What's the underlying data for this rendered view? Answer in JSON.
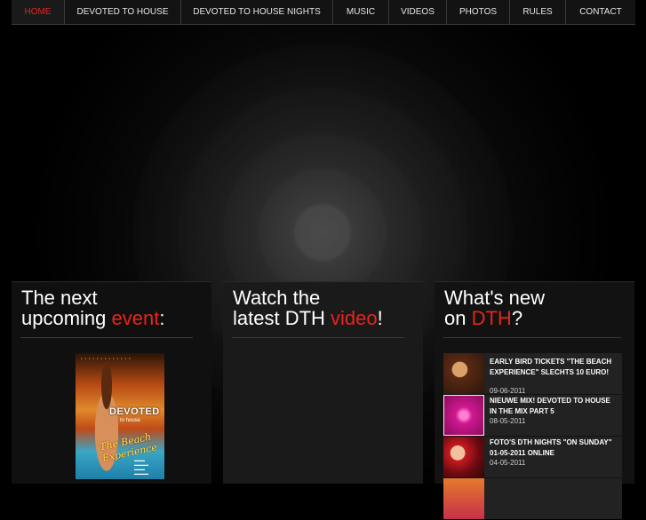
{
  "nav": {
    "items": [
      {
        "label": "HOME",
        "active": true
      },
      {
        "label": "DEVOTED TO HOUSE",
        "active": false
      },
      {
        "label": "DEVOTED TO HOUSE NIGHTS",
        "active": false
      },
      {
        "label": "MUSIC",
        "active": false
      },
      {
        "label": "VIDEOS",
        "active": false
      },
      {
        "label": "PHOTOS",
        "active": false
      },
      {
        "label": "RULES",
        "active": false
      },
      {
        "label": "CONTACT",
        "active": false
      }
    ]
  },
  "colors": {
    "accent": "#e8241d",
    "background": "#000000",
    "panel": "#151515"
  },
  "event_panel": {
    "title_line1": "The next",
    "title_line2_prefix": "upcoming ",
    "title_line2_highlight": "event",
    "title_line2_suffix": ":",
    "poster": {
      "logo": "DEVOTED",
      "sub": "to house",
      "script": "The Beach Experience"
    }
  },
  "video_panel": {
    "title_line1": "Watch the",
    "title_line2_prefix": "latest DTH ",
    "title_line2_highlight": "video",
    "title_line2_suffix": "!"
  },
  "news_panel": {
    "title_line1": "What's new",
    "title_line2_prefix": "on ",
    "title_line2_highlight": "DTH",
    "title_line2_suffix": "?",
    "items": [
      {
        "title": "EARLY BIRD TICKETS \"THE BEACH EXPERIENCE\" SLECHTS 10 EURO!",
        "date": "09-06-2011",
        "thumb": "party-girl-thumbnail"
      },
      {
        "title": "NIEUWE MIX! DEVOTED TO HOUSE IN THE MIX PART 5",
        "date": "08-05-2011",
        "thumb": "mix-cover-thumbnail"
      },
      {
        "title": "FOTO'S DTH NIGHTS \"ON SUNDAY\" 01-05-2011 ONLINE",
        "date": "04-05-2011",
        "thumb": "photos-thumbnail"
      }
    ]
  }
}
